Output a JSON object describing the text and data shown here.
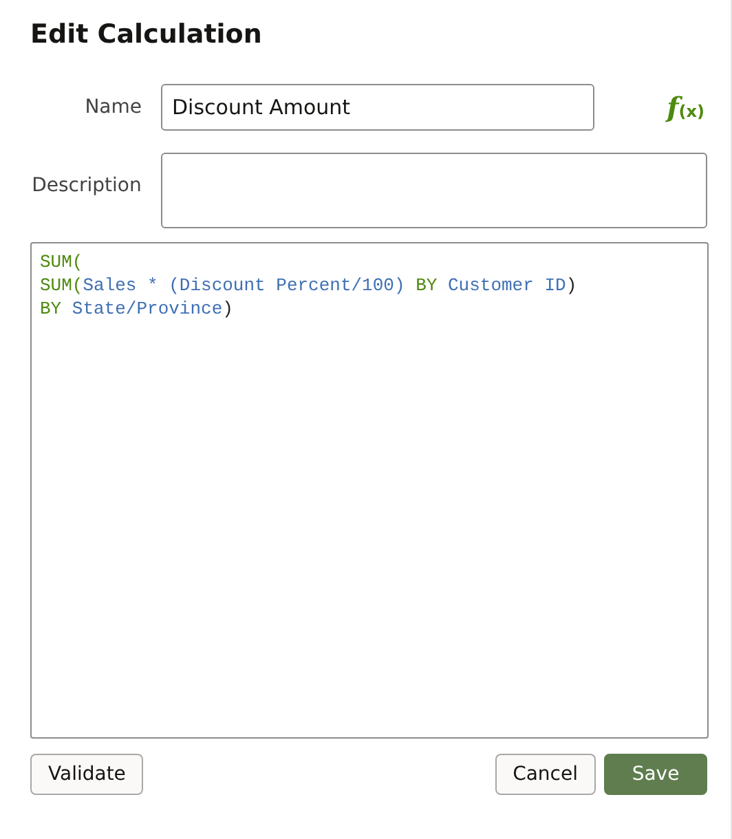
{
  "title": "Edit Calculation",
  "name": {
    "label": "Name",
    "value": "Discount Amount"
  },
  "formula_button": {
    "symbol": "f",
    "argument": "(x)"
  },
  "description": {
    "label": "Description"
  },
  "expression": [
    {
      "tokens": [
        {
          "kind": "function",
          "text": "SUM("
        }
      ]
    },
    {
      "tokens": [
        {
          "kind": "function",
          "text": "SUM("
        },
        {
          "kind": "column",
          "text": "Sales * (Discount Percent/100)"
        },
        {
          "kind": "keyword",
          "text": " BY "
        },
        {
          "kind": "column",
          "text": "Customer ID"
        },
        {
          "kind": "plain",
          "text": ")"
        }
      ]
    },
    {
      "tokens": [
        {
          "kind": "keyword",
          "text": "BY "
        },
        {
          "kind": "column",
          "text": "State/Province"
        },
        {
          "kind": "plain",
          "text": ")"
        }
      ]
    }
  ],
  "buttons": [
    {
      "label": "Validate",
      "kind": "secondary"
    },
    {
      "label": "Cancel",
      "kind": "secondary"
    },
    {
      "label": "Save",
      "kind": "primary"
    }
  ]
}
